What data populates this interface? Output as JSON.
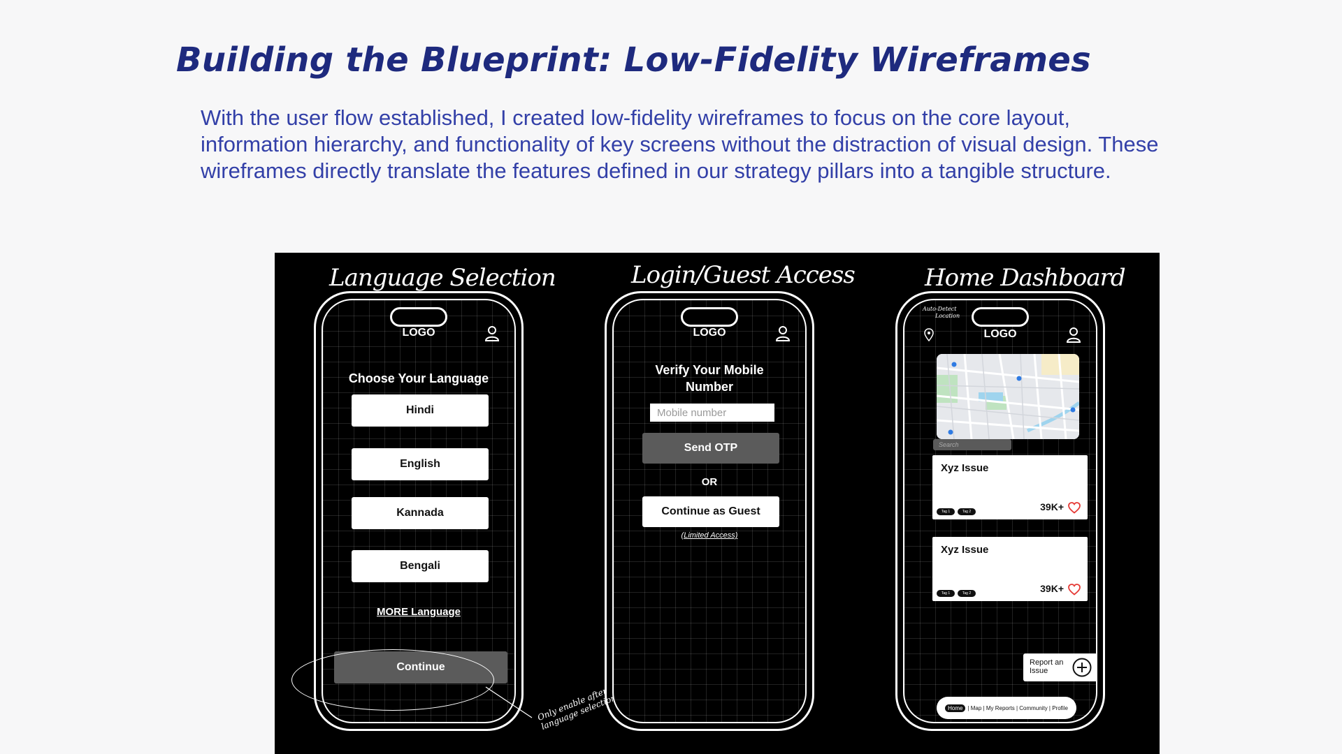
{
  "title": "Building the Blueprint: Low-Fidelity Wireframes",
  "intro": "With the user flow established, I created low-fidelity wireframes to focus on the core layout, information hierarchy, and functionality of key screens without the distraction of visual design. These wireframes directly translate the features defined in our strategy pillars into a tangible structure.",
  "screens": {
    "language": {
      "caption": "Language Selection",
      "logo": "LOGO",
      "heading": "Choose Your Language",
      "options": [
        "Hindi",
        "English",
        "Kannada",
        "Bengali"
      ],
      "more": "MORE Language",
      "continue": "Continue",
      "annotation_line1": "Only enable after",
      "annotation_line2": "language selection"
    },
    "login": {
      "caption": "Login/Guest Access",
      "logo": "LOGO",
      "heading": "Verify Your Mobile Number",
      "input_placeholder": "Mobile number",
      "send_otp": "Send OTP",
      "or": "OR",
      "guest": "Continue as Guest",
      "limited": "(Limited Access)"
    },
    "home": {
      "caption": "Home Dashboard",
      "logo": "LOGO",
      "auto_detect_line1": "Auto-Detect",
      "auto_detect_line2": "Location",
      "search_placeholder": "Search",
      "issues": [
        {
          "title": "Xyz Issue",
          "count": "39K+",
          "tags": [
            "Tag 1",
            "Tag 2"
          ]
        },
        {
          "title": "Xyz Issue",
          "count": "39K+",
          "tags": [
            "Tag 1",
            "Tag 2"
          ]
        }
      ],
      "report": "Report an Issue",
      "nav": {
        "home": "Home",
        "rest": "| Map | My Reports | Community | Profile"
      }
    }
  },
  "colors": {
    "title": "#1e2a7e",
    "body_text": "#3340a8",
    "board": "#000000",
    "heart": "#e53935"
  },
  "icons": [
    "user-icon",
    "location-pin-icon",
    "heart-icon",
    "plus-circle-icon",
    "map-image"
  ]
}
